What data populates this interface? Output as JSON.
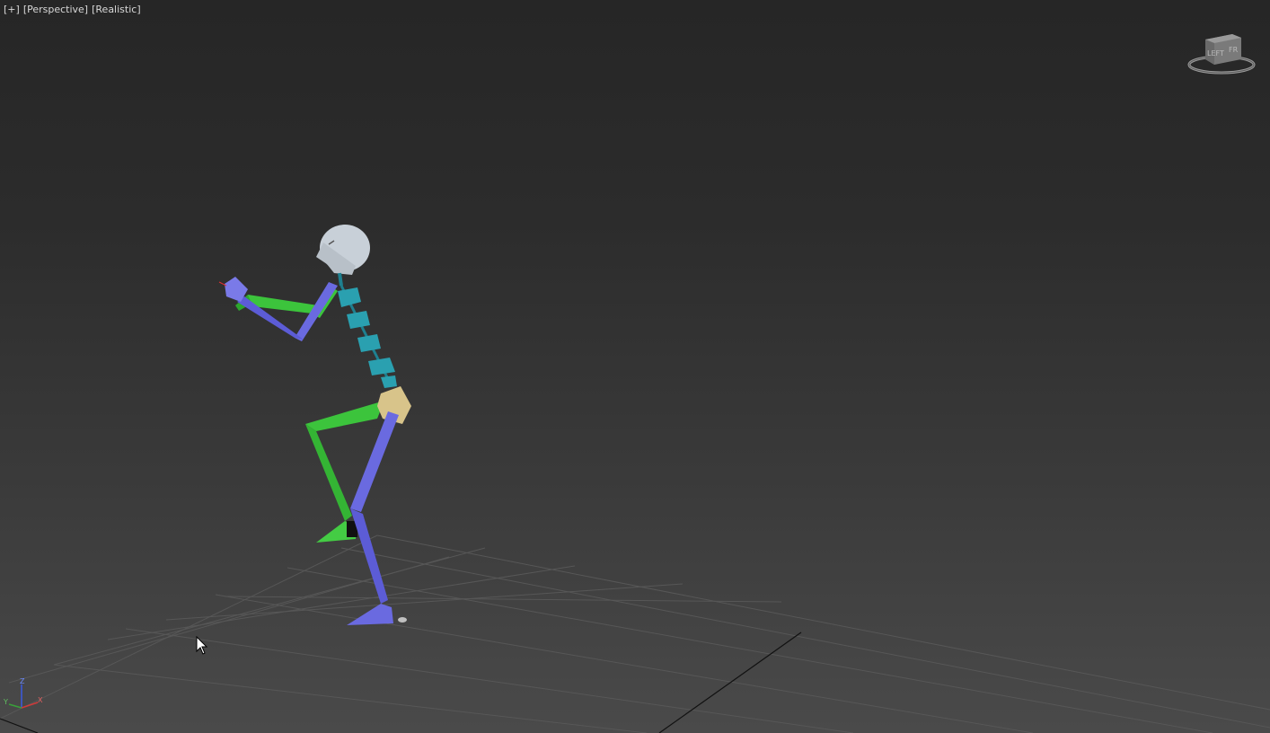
{
  "viewport": {
    "menu_label": "[+]",
    "view_label": "[Perspective]",
    "shading_label": "[Realistic]"
  },
  "viewcube": {
    "face_left": "LEFT",
    "face_front": "FR"
  },
  "axis_tripod": {
    "x": "X",
    "y": "Y",
    "z": "Z"
  },
  "colors": {
    "background_top": "#262626",
    "background_bottom": "#4a4a4a",
    "grid": "#585858",
    "bone_blue": "#6a6ae0",
    "bone_green": "#3cc43c",
    "spine_cyan": "#2aa0b0",
    "pelvis_tan": "#d8c48a",
    "head_gray": "#c8d0d8"
  },
  "icons": [
    "viewcube-icon",
    "axis-tripod-icon",
    "mouse-cursor-icon"
  ]
}
